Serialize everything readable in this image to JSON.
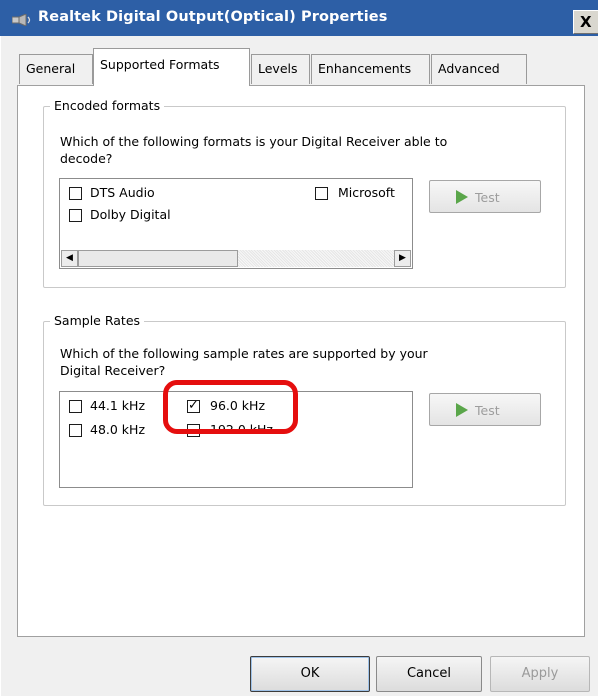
{
  "window": {
    "title": "Realtek Digital Output(Optical) Properties",
    "close_label": "X",
    "icon": "speaker-icon"
  },
  "tabs": [
    {
      "label": "General",
      "active": false
    },
    {
      "label": "Supported Formats",
      "active": true
    },
    {
      "label": "Levels",
      "active": false
    },
    {
      "label": "Enhancements",
      "active": false
    },
    {
      "label": "Advanced",
      "active": false
    }
  ],
  "encoded_formats": {
    "title": "Encoded formats",
    "description_line1": "Which of the following formats is your Digital Receiver able to",
    "description_line2": "decode?",
    "items": [
      {
        "label": "DTS Audio",
        "checked": false
      },
      {
        "label": "Dolby Digital",
        "checked": false
      },
      {
        "label": "Microsoft",
        "checked": false
      }
    ],
    "test_label": "Test"
  },
  "sample_rates": {
    "title": "Sample Rates",
    "description_line1": "Which of the following sample rates are supported by your",
    "description_line2": "Digital Receiver?",
    "items": [
      {
        "label": "44.1 kHz",
        "checked": false
      },
      {
        "label": "48.0 kHz",
        "checked": false
      },
      {
        "label": "96.0 kHz",
        "checked": true
      },
      {
        "label": "192.0 kHz",
        "checked": false
      }
    ],
    "test_label": "Test"
  },
  "footer": {
    "ok_label": "OK",
    "cancel_label": "Cancel",
    "apply_label": "Apply"
  },
  "colors": {
    "titlebar": "#2d5fa6",
    "highlight": "#e50e0e",
    "play_icon": "#5aa64a"
  }
}
